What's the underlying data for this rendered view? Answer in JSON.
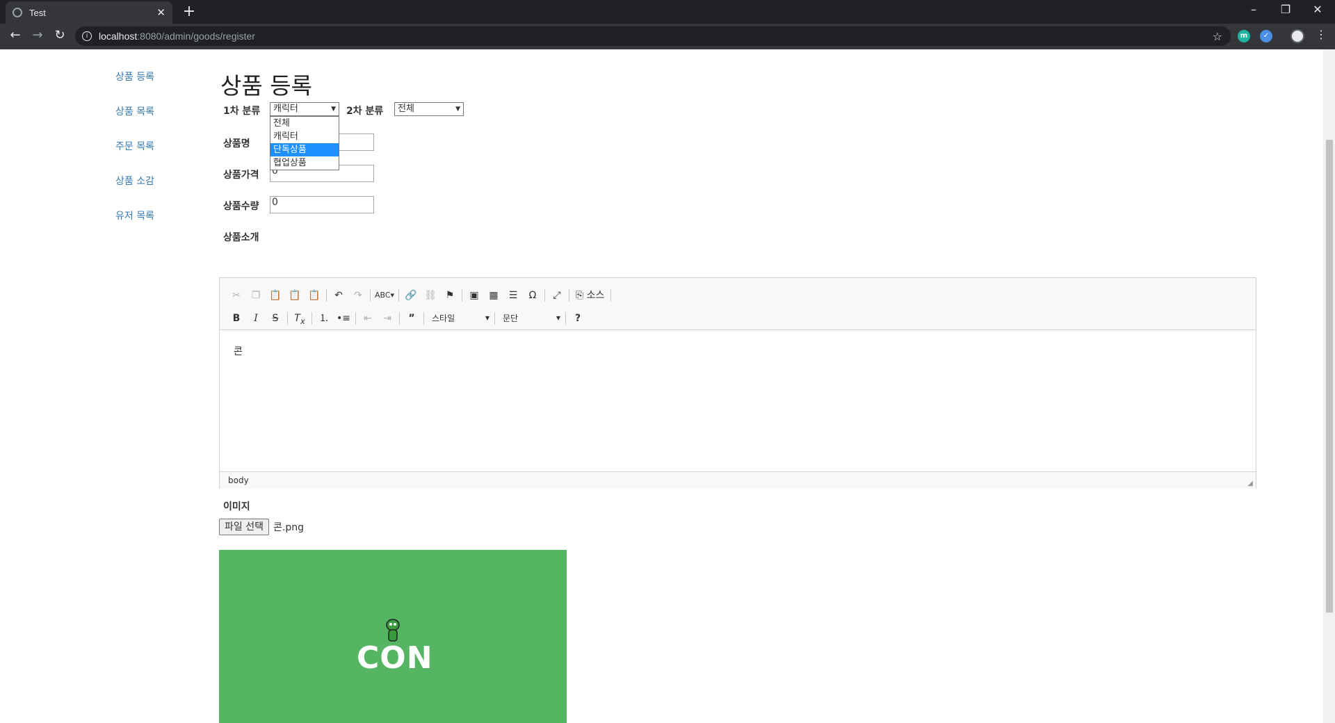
{
  "browser": {
    "tab_title": "Test",
    "url_host": "localhost",
    "url_path": ":8080/admin/goods/register",
    "new_tab": "+",
    "tab_close": "✕"
  },
  "sidebar": {
    "items": [
      {
        "label": "상품 등록"
      },
      {
        "label": "상품 목록"
      },
      {
        "label": "주문 목록"
      },
      {
        "label": "상품 소감"
      },
      {
        "label": "유저 목록"
      }
    ]
  },
  "form": {
    "title": "상품 등록",
    "cat1_label": "1차 분류",
    "cat1_value": "캐릭터",
    "cat1_options": [
      "전체",
      "캐릭터",
      "단독상품",
      "협업상품"
    ],
    "cat1_highlighted": "단독상품",
    "cat2_label": "2차 분류",
    "cat2_value": "전체",
    "name_label": "상품명",
    "name_value": "",
    "price_label": "상품가격",
    "price_value": "0",
    "qty_label": "상품수량",
    "qty_value": "0",
    "desc_label": "상품소개"
  },
  "editor": {
    "style_combo": "스타일",
    "format_combo": "문단",
    "source_label": "소스",
    "content": "콘",
    "status_path": "body"
  },
  "image": {
    "label": "이미지",
    "file_button": "파일 선택",
    "file_name": "콘.png",
    "preview_text": "CON",
    "preview_bg": "#55b563"
  }
}
